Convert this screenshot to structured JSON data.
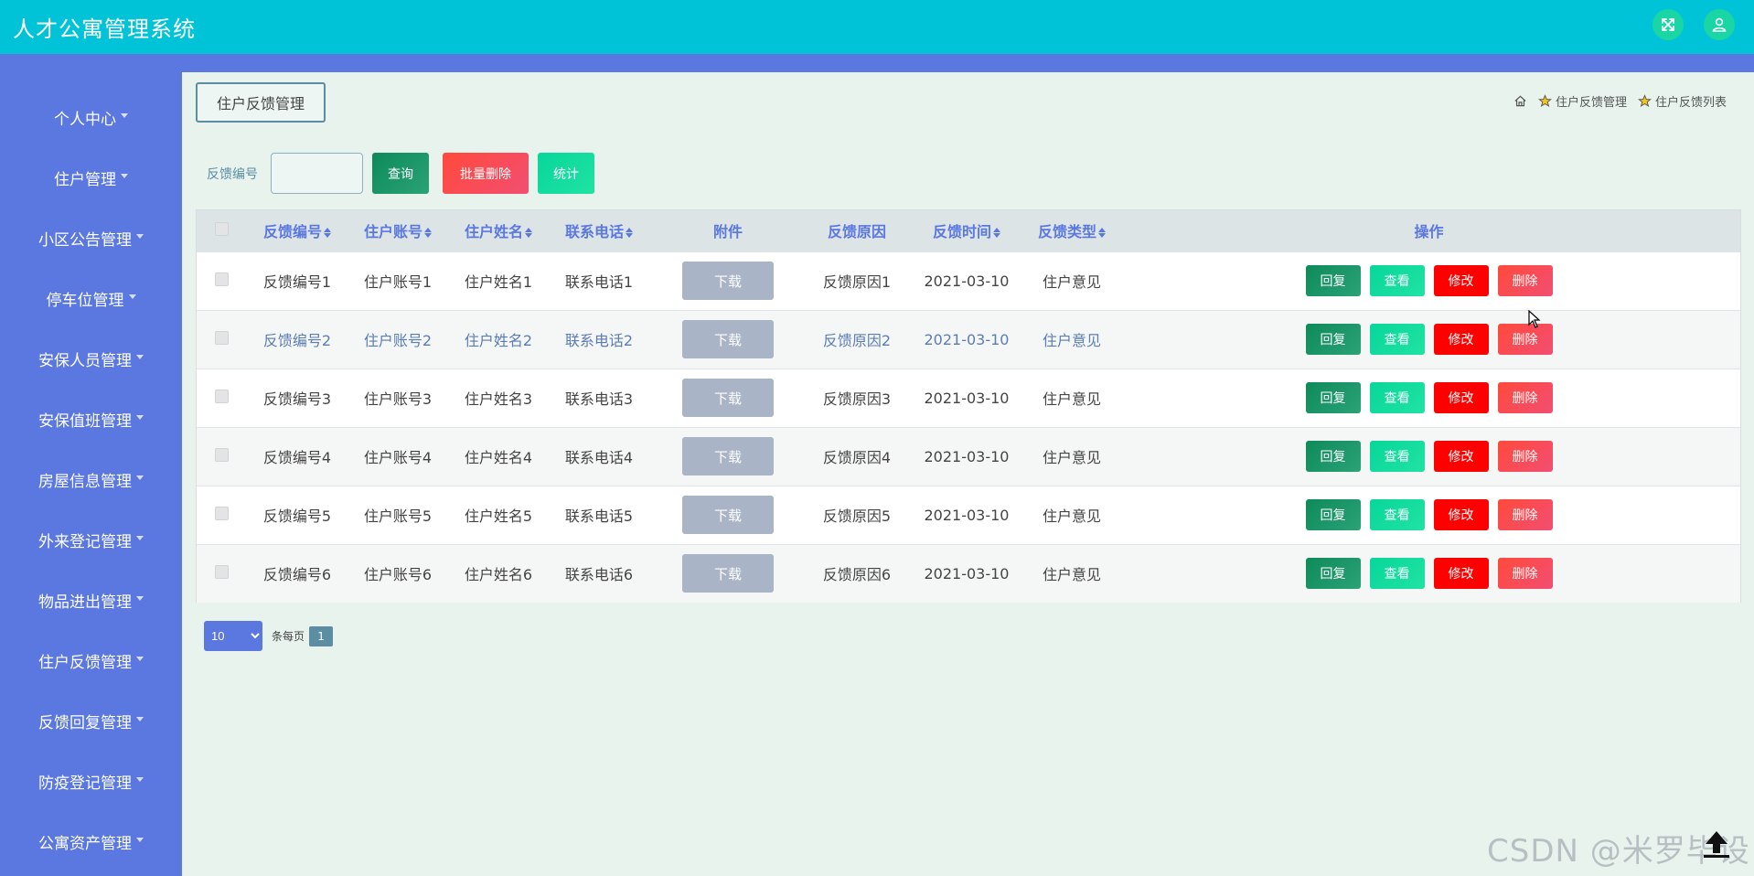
{
  "header": {
    "title": "人才公寓管理系统",
    "fullscreen_icon": "fullscreen-icon",
    "user_icon": "user-icon"
  },
  "sidebar": {
    "items": [
      {
        "label": "个人中心"
      },
      {
        "label": "住户管理"
      },
      {
        "label": "小区公告管理"
      },
      {
        "label": "停车位管理"
      },
      {
        "label": "安保人员管理"
      },
      {
        "label": "安保值班管理"
      },
      {
        "label": "房屋信息管理"
      },
      {
        "label": "外来登记管理"
      },
      {
        "label": "物品进出管理"
      },
      {
        "label": "住户反馈管理"
      },
      {
        "label": "反馈回复管理"
      },
      {
        "label": "防疫登记管理"
      },
      {
        "label": "公寓资产管理"
      }
    ]
  },
  "page": {
    "tab_label": "住户反馈管理",
    "breadcrumb": [
      "住户反馈管理",
      "住户反馈列表"
    ]
  },
  "search": {
    "label": "反馈编号",
    "value": "",
    "query_button": "查询",
    "batch_delete_button": "批量删除",
    "stats_button": "统计"
  },
  "table": {
    "columns": [
      "反馈编号",
      "住户账号",
      "住户姓名",
      "联系电话",
      "附件",
      "反馈原因",
      "反馈时间",
      "反馈类型",
      "操作"
    ],
    "download_label": "下载",
    "actions": {
      "reply": "回复",
      "view": "查看",
      "edit": "修改",
      "delete": "删除"
    },
    "rows": [
      {
        "id": "反馈编号1",
        "account": "住户账号1",
        "name": "住户姓名1",
        "phone": "联系电话1",
        "reason": "反馈原因1",
        "time": "2021-03-10",
        "type": "住户意见"
      },
      {
        "id": "反馈编号2",
        "account": "住户账号2",
        "name": "住户姓名2",
        "phone": "联系电话2",
        "reason": "反馈原因2",
        "time": "2021-03-10",
        "type": "住户意见"
      },
      {
        "id": "反馈编号3",
        "account": "住户账号3",
        "name": "住户姓名3",
        "phone": "联系电话3",
        "reason": "反馈原因3",
        "time": "2021-03-10",
        "type": "住户意见"
      },
      {
        "id": "反馈编号4",
        "account": "住户账号4",
        "name": "住户姓名4",
        "phone": "联系电话4",
        "reason": "反馈原因4",
        "time": "2021-03-10",
        "type": "住户意见"
      },
      {
        "id": "反馈编号5",
        "account": "住户账号5",
        "name": "住户姓名5",
        "phone": "联系电话5",
        "reason": "反馈原因5",
        "time": "2021-03-10",
        "type": "住户意见"
      },
      {
        "id": "反馈编号6",
        "account": "住户账号6",
        "name": "住户姓名6",
        "phone": "联系电话6",
        "reason": "反馈原因6",
        "time": "2021-03-10",
        "type": "住户意见"
      }
    ]
  },
  "pagination": {
    "page_size": "10",
    "per_page_label": "条每页",
    "current_page": "1"
  },
  "watermark": "CSDN @米罗毕设",
  "colors": {
    "topbar": "#00c3d8",
    "sidebar": "#5a78e0",
    "content_bg": "#e8f3ee",
    "edit_button": "#ff0000"
  }
}
